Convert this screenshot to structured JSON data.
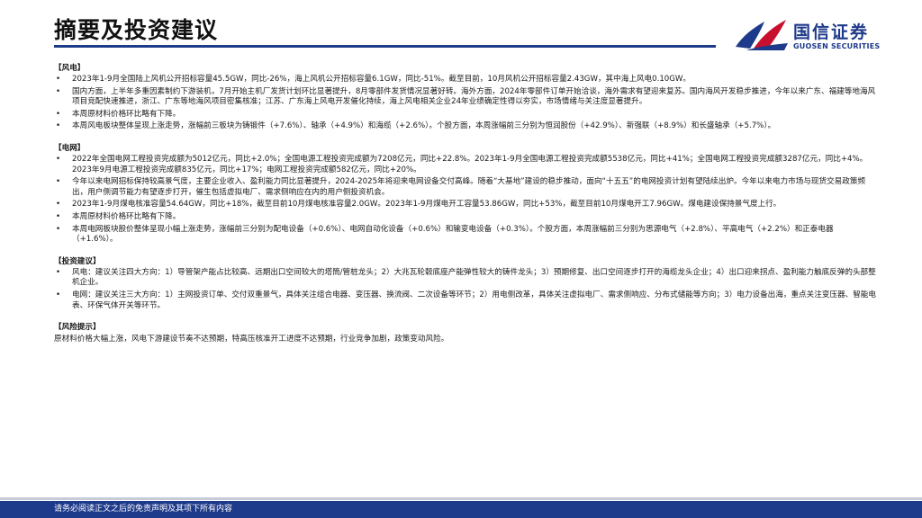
{
  "header": {
    "title": "摘要及投资建议",
    "logo_cn": "国信证券",
    "logo_en": "GUOSEN SECURITIES",
    "brand_blue": "#1e3a8a",
    "brand_red": "#c8102e"
  },
  "sections": {
    "wind": {
      "heading": "【风电】",
      "items": [
        "2023年1-9月全国陆上风机公开招标容量45.5GW，同比-26%，海上风机公开招标容量6.1GW，同比-51%。截至目前，10月风机公开招标容量2.43GW，其中海上风电0.10GW。",
        "国内方面，上半年多重因素制约下游装机，7月开始主机厂发货计划环比显著提升，8月零部件发货情况显著好转。海外方面，2024年零部件订单开始洽谈，海外需求有望迎来复苏。国内海风开发稳步推进，今年以来广东、福建等地海风项目竞配快速推进，浙江、广东等地海风项目密集核准；江苏、广东海上风电开发催化持续，海上风电相关企业24年业绩确定性得以夯实，市场情绪与关注度显著提升。",
        "本周原材料价格环比略有下降。",
        "本周风电板块整体呈现上涨走势，涨幅前三板块为铸锻件（+7.6%）、轴承（+4.9%）和海缆（+2.6%）。个股方面，本周涨幅前三分别为恒润股份（+42.9%）、新强联（+8.9%）和长盛轴承（+5.7%）。"
      ]
    },
    "grid": {
      "heading": "【电网】",
      "items": [
        "2022年全国电网工程投资完成额为5012亿元，同比+2.0%；全国电源工程投资完成额为7208亿元，同比+22.8%。2023年1-9月全国电源工程投资完成额5538亿元，同比+41%；全国电网工程投资完成额3287亿元，同比+4%。2023年9月电源工程投资完成额835亿元，同比+17%；电网工程投资完成额582亿元，同比+20%。",
        "今年以来电网招标保持较高景气度，主要企业收入、盈利能力同比显著提升，2024-2025年将迎来电网设备交付高峰。随着“大基地”建设的稳步推动，面向“十五五”的电网投资计划有望陆续出炉。今年以来电力市场与现货交易政策频出，用户侧调节能力有望逐步打开，催生包括虚拟电厂、需求侧响应在内的用户侧投资机会。",
        "2023年1-9月煤电核准容量54.64GW，同比+18%，截至目前10月煤电核准容量2.0GW。2023年1-9月煤电开工容量53.86GW，同比+53%，截至目前10月煤电开工7.96GW。煤电建设保持景气度上行。",
        "本周原材料价格环比略有下降。",
        "本周电网板块股价整体呈现小幅上涨走势，涨幅前三分别为配电设备（+0.6%）、电网自动化设备（+0.6%）和输变电设备（+0.3%）。个股方面，本周涨幅前三分别为思源电气（+2.8%）、平高电气（+2.2%）和正泰电器（+1.6%）。"
      ]
    },
    "advice": {
      "heading": "【投资建议】",
      "items": [
        "风电：建议关注四大方向：1）导管架产能占比较高、远期出口空间较大的塔筒/管桩龙头；2）大兆瓦轮毂底座产能弹性较大的铸件龙头；3）预期修复、出口空间逐步打开的海缆龙头企业；4）出口迎来拐点、盈利能力触底反弹的头部整机企业。",
        "电网：建议关注三大方向：1）主网投资订单、交付双重景气，具体关注组合电器、变压器、换流阀、二次设备等环节；2）用电侧改革，具体关注虚拟电厂、需求侧响应、分布式储能等方向；3）电力设备出海，重点关注变压器、智能电表、环保气体开关等环节。"
      ]
    },
    "risk": {
      "heading": "【风险提示】",
      "text": "原材料价格大幅上涨，风电下游建设节奏不达预期，特高压核准开工进度不达预期，行业竞争加剧，政策变动风险。"
    }
  },
  "footer": {
    "text": "请务必阅读正文之后的免责声明及其项下所有内容"
  },
  "bullet_glyph": "•"
}
